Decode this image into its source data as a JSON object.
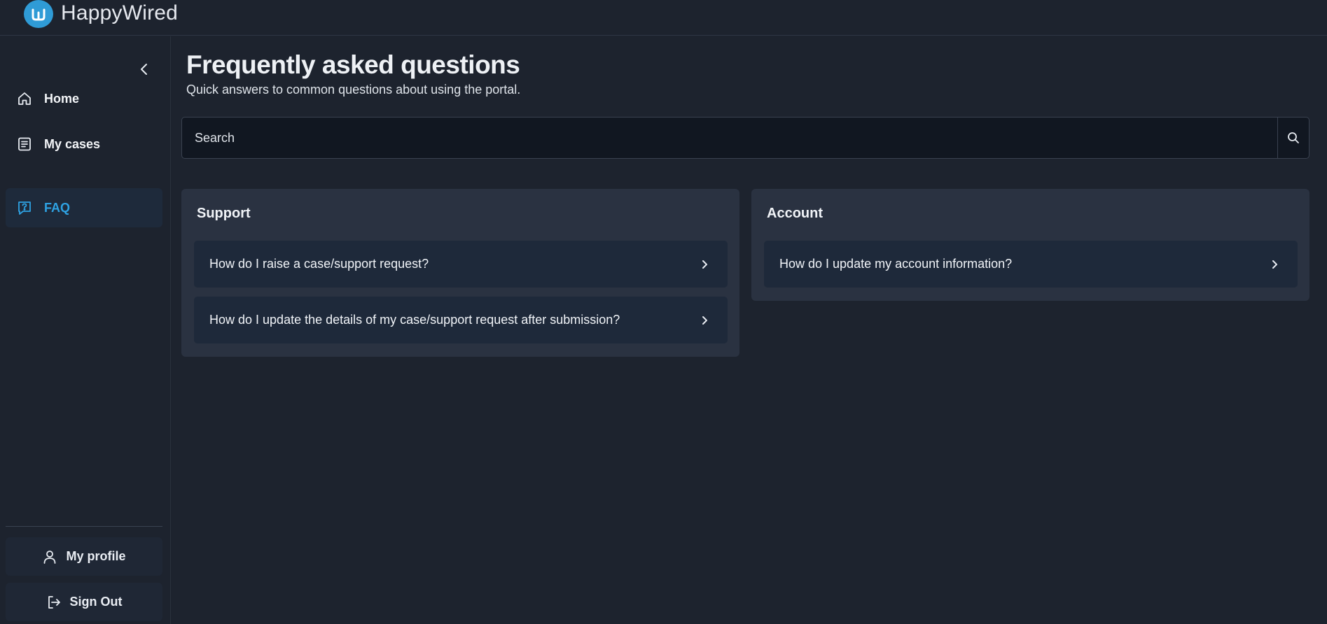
{
  "app": {
    "brand": "HappyWired"
  },
  "sidebar": {
    "items": [
      {
        "label": "Home",
        "icon": "home-icon",
        "active": false
      },
      {
        "label": "My cases",
        "icon": "document-icon",
        "active": false
      },
      {
        "label": "FAQ",
        "icon": "faq-icon",
        "active": true
      }
    ],
    "profile_label": "My profile",
    "signout_label": "Sign Out"
  },
  "page": {
    "title": "Frequently asked questions",
    "subtitle": "Quick answers to common questions about using the portal."
  },
  "search": {
    "placeholder": "Search"
  },
  "sections": [
    {
      "title": "Support",
      "questions": [
        "How do I raise a case/support request?",
        "How do I update the details of my case/support request after submission?"
      ]
    },
    {
      "title": "Account",
      "questions": [
        "How do I update my account information?"
      ]
    }
  ],
  "colors": {
    "background": "#1d232e",
    "accent": "#2ea2e3",
    "card": "#2a3241",
    "item": "#1e293a"
  }
}
